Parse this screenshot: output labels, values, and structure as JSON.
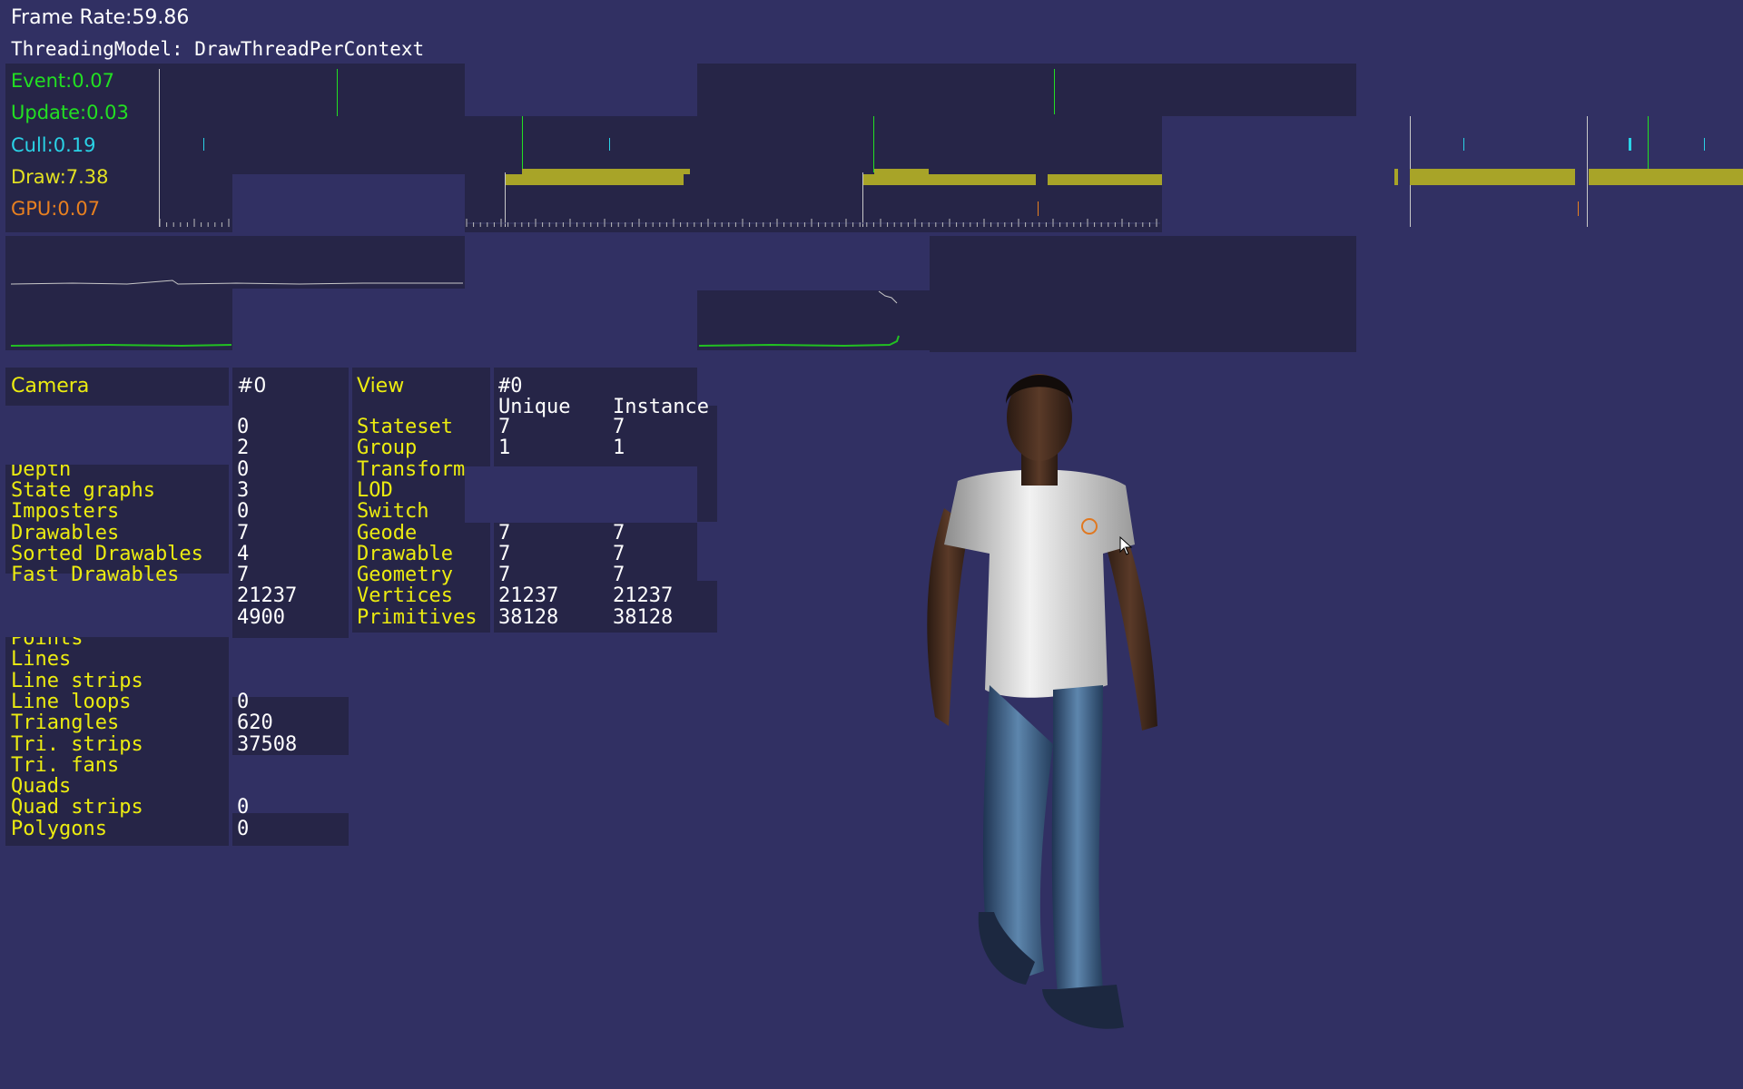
{
  "header": {
    "frame_rate": "Frame Rate:59.86",
    "threading_model": "ThreadingModel: DrawThreadPerContext"
  },
  "timing": {
    "event": "Event:0.07",
    "update": "Update:0.03",
    "cull": "Cull:0.19",
    "draw": "Draw:7.38",
    "gpu": "GPU:0.07",
    "colors": {
      "event": "#22e022",
      "update": "#22e022",
      "cull": "#2ad2e6",
      "draw": "#e2e022",
      "gpu": "#e88020",
      "draw_bar": "#a8a428"
    }
  },
  "camera_stats": {
    "header_label": "Camera",
    "header_value": "#0",
    "rows": [
      {
        "label": "",
        "value": "0"
      },
      {
        "label": "",
        "value": "2"
      },
      {
        "label": "Depth",
        "value": "0"
      },
      {
        "label": "State graphs",
        "value": "3"
      },
      {
        "label": "Imposters",
        "value": "0"
      },
      {
        "label": "Drawables",
        "value": "7"
      },
      {
        "label": "Sorted Drawables",
        "value": "4"
      },
      {
        "label": "Fast Drawables",
        "value": "7"
      },
      {
        "label": "",
        "value": "21237"
      },
      {
        "label": "",
        "value": "4900"
      },
      {
        "label": "Points",
        "value": ""
      },
      {
        "label": "Lines",
        "value": ""
      },
      {
        "label": "Line strips",
        "value": ""
      },
      {
        "label": "Line loops",
        "value": "0"
      },
      {
        "label": "Triangles",
        "value": "620"
      },
      {
        "label": "Tri. strips",
        "value": "37508"
      },
      {
        "label": "Tri. fans",
        "value": ""
      },
      {
        "label": "Quads",
        "value": ""
      },
      {
        "label": "Quad strips",
        "value": "0"
      },
      {
        "label": "Polygons",
        "value": "0"
      }
    ]
  },
  "view_stats": {
    "header_label": "View",
    "header_value": "#0",
    "col_unique": "Unique",
    "col_instanced": "Instance",
    "rows": [
      {
        "label": "Stateset",
        "unique": "7",
        "instanced": "7"
      },
      {
        "label": "Group",
        "unique": "1",
        "instanced": "1"
      },
      {
        "label": "Transform",
        "unique": "",
        "instanced": ""
      },
      {
        "label": "LOD",
        "unique": "",
        "instanced": ""
      },
      {
        "label": "Switch",
        "unique": "",
        "instanced": ""
      },
      {
        "label": "Geode",
        "unique": "7",
        "instanced": "7"
      },
      {
        "label": "Drawable",
        "unique": "7",
        "instanced": "7"
      },
      {
        "label": "Geometry",
        "unique": "7",
        "instanced": "7"
      },
      {
        "label": "Vertices",
        "unique": "21237",
        "instanced": "21237"
      },
      {
        "label": "Primitives",
        "unique": "38128",
        "instanced": "38128"
      }
    ]
  },
  "colors": {
    "background": "#313063",
    "panel": "#262547",
    "stats_text": "#ecec10",
    "value_text": "#ffffff"
  }
}
